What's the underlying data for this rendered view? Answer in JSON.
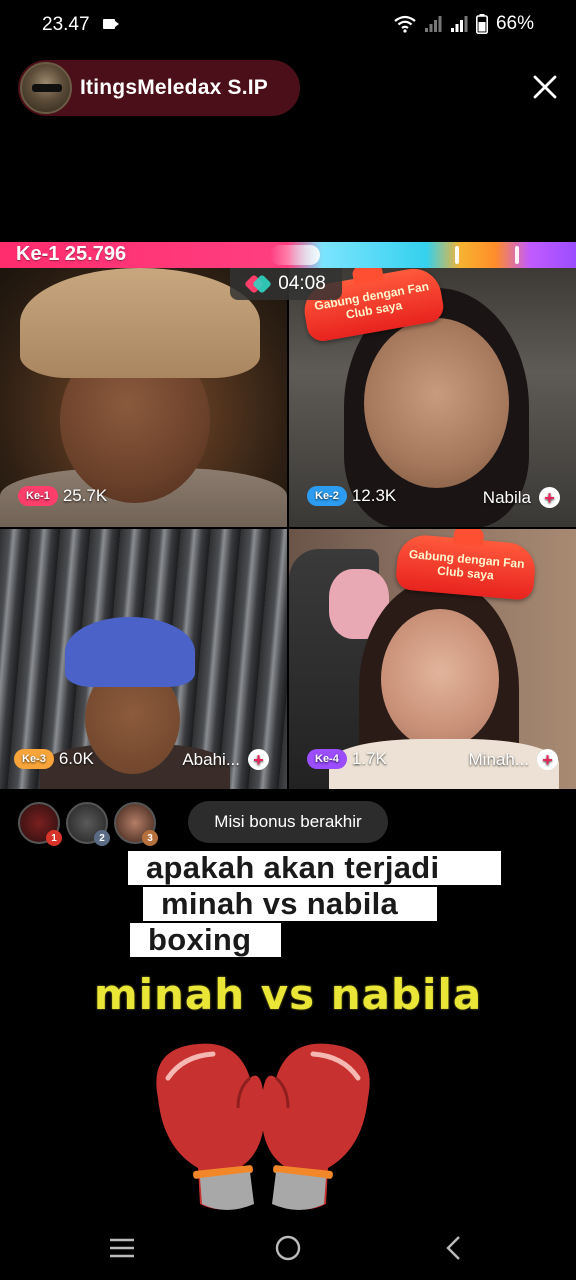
{
  "status_bar": {
    "time": "23.47",
    "battery_percent": "66%"
  },
  "host": {
    "name": "ItingsMeledax S.IP"
  },
  "battle": {
    "label": "Ke-1 25.796",
    "timer": "04:08"
  },
  "participants": [
    {
      "rank": "Ke-1",
      "score": "25.7K",
      "name": "",
      "rank_color": "#ff3e6c"
    },
    {
      "rank": "Ke-2",
      "score": "12.3K",
      "name": "Nabila",
      "rank_color": "#2c9cf0"
    },
    {
      "rank": "Ke-3",
      "score": "6.0K",
      "name": "Abahi...",
      "rank_color": "#f7a53a"
    },
    {
      "rank": "Ke-4",
      "score": "1.7K",
      "name": "Minah...",
      "rank_color": "#9b4dff"
    }
  ],
  "fan_club_badge": "Gabung dengan Fan Club saya",
  "viewer_ranks": [
    "1",
    "2",
    "3"
  ],
  "mission_text": "Misi bonus berakhir",
  "captions": [
    "apakah akan terjadi",
    "minah vs nabila",
    "boxing"
  ],
  "big_title": "minah vs nabila",
  "colors": {
    "accent_pink": "#ff2c6e",
    "title_yellow": "#e9e637",
    "host_pill_bg": "#4a0f18"
  },
  "icons": {
    "close": "close-icon",
    "add": "plus-icon",
    "timer": "battle-icon",
    "gloves": "boxing-gloves-icon"
  }
}
